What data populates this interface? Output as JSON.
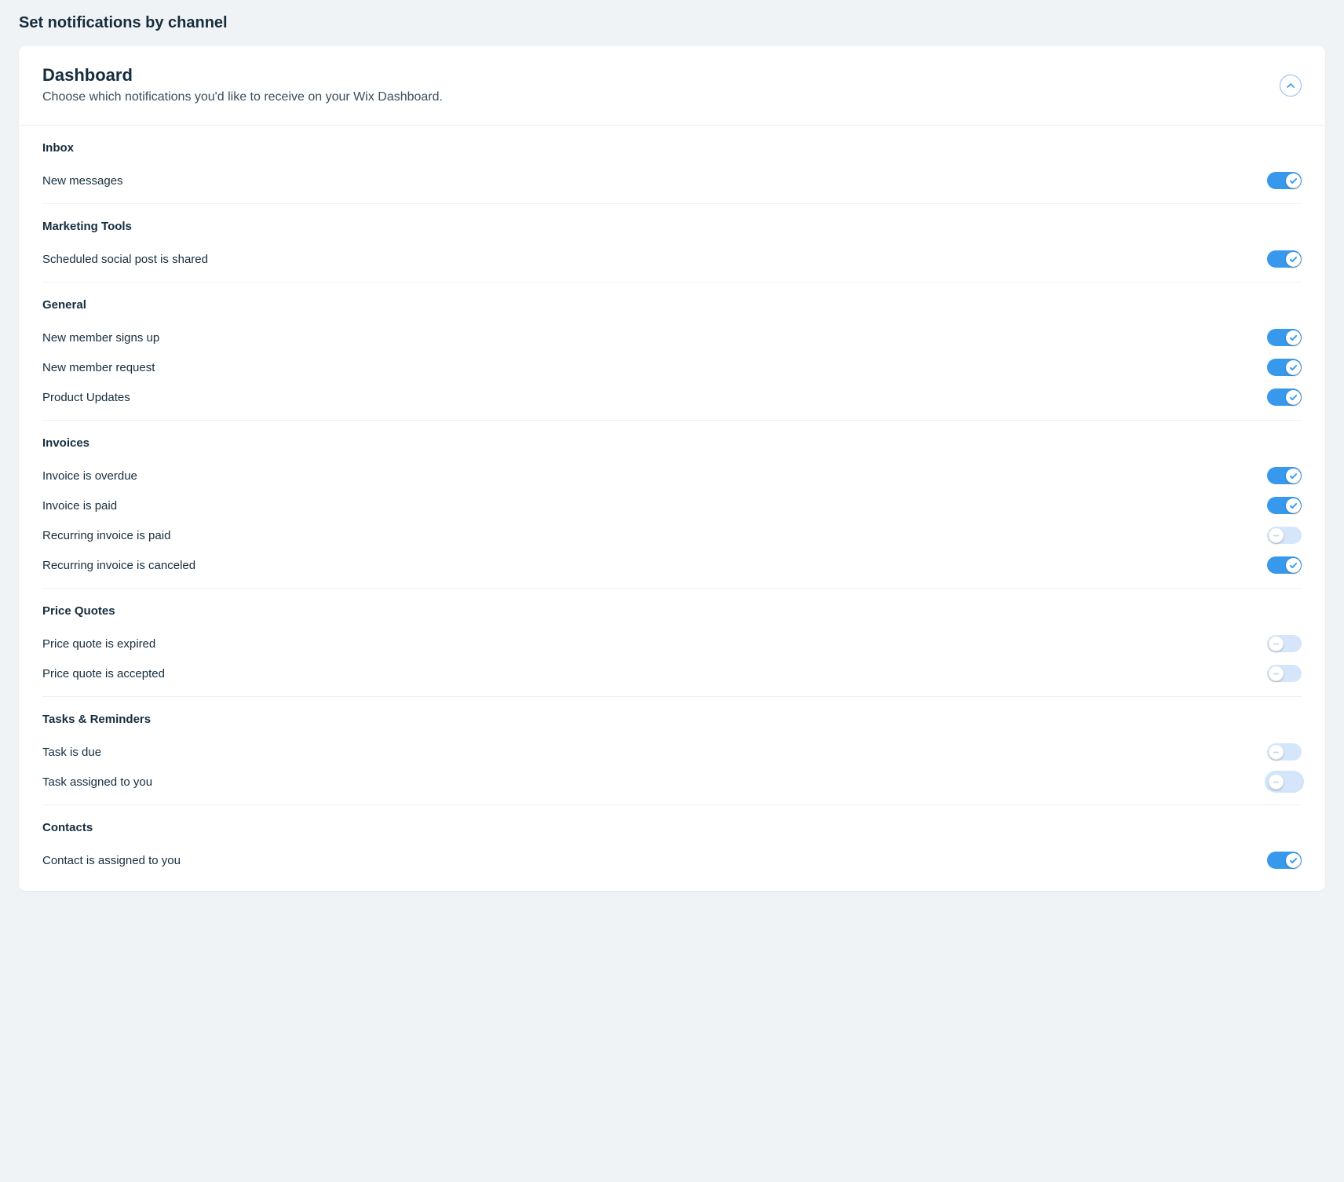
{
  "page": {
    "title": "Set notifications by channel"
  },
  "card": {
    "title": "Dashboard",
    "subtitle": "Choose which notifications you'd like to receive on your Wix Dashboard."
  },
  "groups": [
    {
      "title": "Inbox",
      "items": [
        {
          "label": "New messages",
          "on": true,
          "focus": false
        }
      ]
    },
    {
      "title": "Marketing Tools",
      "items": [
        {
          "label": "Scheduled social post is shared",
          "on": true,
          "focus": false
        }
      ]
    },
    {
      "title": "General",
      "items": [
        {
          "label": "New member signs up",
          "on": true,
          "focus": false
        },
        {
          "label": "New member request",
          "on": true,
          "focus": false
        },
        {
          "label": "Product Updates",
          "on": true,
          "focus": false
        }
      ]
    },
    {
      "title": "Invoices",
      "items": [
        {
          "label": "Invoice is overdue",
          "on": true,
          "focus": false
        },
        {
          "label": "Invoice is paid",
          "on": true,
          "focus": false
        },
        {
          "label": "Recurring invoice is paid",
          "on": false,
          "focus": false
        },
        {
          "label": "Recurring invoice is canceled",
          "on": true,
          "focus": false
        }
      ]
    },
    {
      "title": "Price Quotes",
      "items": [
        {
          "label": "Price quote is expired",
          "on": false,
          "focus": false
        },
        {
          "label": "Price quote is accepted",
          "on": false,
          "focus": false
        }
      ]
    },
    {
      "title": "Tasks & Reminders",
      "items": [
        {
          "label": "Task is due",
          "on": false,
          "focus": false
        },
        {
          "label": "Task assigned to you",
          "on": false,
          "focus": true
        }
      ]
    },
    {
      "title": "Contacts",
      "items": [
        {
          "label": "Contact is assigned to you",
          "on": true,
          "focus": false
        }
      ]
    }
  ]
}
